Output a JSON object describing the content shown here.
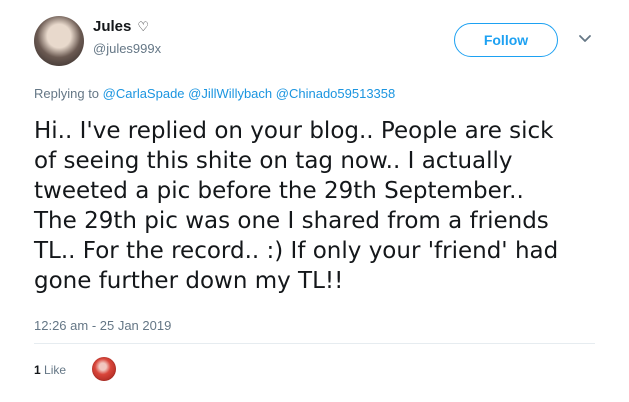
{
  "user": {
    "name": "Jules",
    "badge": "♡",
    "handle": "@jules999x"
  },
  "follow_label": "Follow",
  "reply": {
    "prefix": "Replying to",
    "mentions": [
      "@CarlaSpade",
      "@JillWillybach",
      "@Chinado59513358"
    ]
  },
  "tweet": {
    "lines": [
      "Hi.. I've replied on your blog.. People are sick",
      "of seeing this shite on tag now.. I actually",
      "tweeted a pic before the 29th September..",
      "The 29th pic was one I shared from a friends",
      "TL.. For the record.. :) If only your 'friend' had",
      "gone further down my TL!!"
    ]
  },
  "timestamp": "12:26 am - 25 Jan 2019",
  "likes": {
    "count": "1",
    "label": "Like"
  },
  "colors": {
    "link": "#1b95e0",
    "follow": "#1da1f2",
    "secondary": "#657786"
  }
}
